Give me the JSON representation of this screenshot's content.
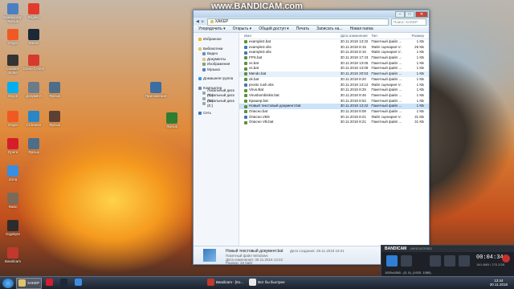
{
  "watermark": "www.BANDICAM.com",
  "desktop": {
    "icons": [
      {
        "label": "Компьютер Ярлык",
        "color": "#4a7fc1"
      },
      {
        "label": "Яндекс",
        "color": "#e23b2e"
      },
      {
        "label": "Origin",
        "color": "#f05a22"
      },
      {
        "label": "Steam",
        "color": "#1b2838"
      },
      {
        "label": "Counter-Strike",
        "color": "#333333"
      },
      {
        "label": "Game Center",
        "color": "#d63a2e"
      },
      {
        "label": "Skype",
        "color": "#00aff0"
      },
      {
        "label": "Документ",
        "color": "#6b7b8c"
      },
      {
        "label": "Ярлык",
        "color": "#4d6e8a"
      },
      {
        "label": "Origin",
        "color": "#f05a22"
      },
      {
        "label": "CCleaner",
        "color": "#2b86c5"
      },
      {
        "label": "Opera",
        "color": "#d51d2c"
      },
      {
        "label": "Ярлык",
        "color": "#4d6e8a"
      },
      {
        "label": "Zona",
        "color": "#3a8de0"
      },
      {
        "label": "Файл",
        "color": "#7a6a5a"
      },
      {
        "label": "Gigabyte",
        "color": "#2c2c2c"
      },
      {
        "label": "Bandicam",
        "color": "#c0392b"
      },
      {
        "label": "Приложение",
        "color": "#3a6ea5"
      },
      {
        "label": "Ярлык",
        "color": "#2e7d32"
      },
      {
        "label": "Ярлык",
        "color": "#5c4033"
      }
    ]
  },
  "explorer": {
    "address": "XAKEP",
    "search_placeholder": "Поиск: XAKEP",
    "toolbar": {
      "organize": "Упорядочить ▾",
      "open": "Открыть ▾",
      "share": "Общий доступ ▾",
      "print": "Печать",
      "burn": "Записать на...",
      "new_folder": "Новая папка"
    },
    "nav": {
      "favorites": "Избранное",
      "libraries": "Библиотеки",
      "video": "Видео",
      "documents": "Документы",
      "images": "Изображения",
      "music": "Музыка",
      "homegroup": "Домашняя группа",
      "computer": "Компьютер",
      "disk_c": "Локальный диск (C:)",
      "disk_d": "Локальный диск (D:)",
      "disk_e": "Локальный диск (E:)",
      "network": "Сеть"
    },
    "columns": {
      "name": "Имя",
      "date": "Дата изменения",
      "type": "Тип",
      "size": "Размер"
    },
    "files": [
      {
        "name": "example2.bat",
        "date": "30.11.2018 13:32",
        "type": "Пакетный файл ...",
        "size": "1 КБ"
      },
      {
        "name": "example3.vbs",
        "date": "30.11.2018 8:16",
        "type": "Файл сценария V...",
        "size": "26 КБ"
      },
      {
        "name": "example3.vbs",
        "date": "30.11.2018 8:16",
        "type": "Файл сценария V...",
        "size": "1 КБ"
      },
      {
        "name": "FPS.bat",
        "date": "30.11.2018 17:43",
        "type": "Пакетный файл ...",
        "size": "1 КБ"
      },
      {
        "name": "vs.bat",
        "date": "30.11.2018 13:06",
        "type": "Пакетный файл ...",
        "size": "1 КБ"
      },
      {
        "name": "vs.bat",
        "date": "30.11.2018 13:06",
        "type": "Пакетный файл ...",
        "size": "1 КБ"
      },
      {
        "name": "Mendo.bat",
        "date": "30.11.2018 20:53",
        "type": "Пакетный файл ...",
        "size": "1 КБ"
      },
      {
        "name": "ok.bat",
        "date": "30.11.2018 8:20",
        "type": "Пакетный файл ...",
        "size": "1 КБ"
      },
      {
        "name": "prosto rush.vbs",
        "date": "30.11.2018 13:12",
        "type": "Файл сценария V...",
        "size": "1 КБ"
      },
      {
        "name": "Virus.Bat",
        "date": "30.11.2018 8:25",
        "type": "Пакетный файл ...",
        "size": "1 КБ"
      },
      {
        "name": "Virusbombiskis.bat",
        "date": "30.11.2018 8:46",
        "type": "Пакетный файл ...",
        "size": "1 КБ"
      },
      {
        "name": "Крашер.bat",
        "date": "30.11.2018 8:52",
        "type": "Пакетный файл ...",
        "size": "1 КБ"
      },
      {
        "name": "Новый текстовый документ.bat",
        "date": "30.11.2018 13:22",
        "type": "Пакетный файл ...",
        "size": "1 КБ"
      },
      {
        "name": "Опасно.bat",
        "date": "30.11.2018 8:08",
        "type": "Пакетный файл ...",
        "size": "1 КБ"
      },
      {
        "name": "Опасно.VBS",
        "date": "30.11.2018 8:21",
        "type": "Файл сценария V...",
        "size": "31 КБ"
      },
      {
        "name": "Опасно VB.bat",
        "date": "30.11.2018 8:21",
        "type": "Пакетный файл ...",
        "size": "31 КБ"
      }
    ],
    "selected_index": 12,
    "hover_index": 6,
    "details": {
      "name": "Новый текстовый документ.bat",
      "type": "Пакетный файл Windows",
      "modified_label": "Дата изменения:",
      "modified": "30.11.2018 13:22",
      "size_label": "Размер:",
      "size": "28 байт",
      "created_label": "Дата создания:",
      "created": "28.11.2018 19:21"
    }
  },
  "bandicam": {
    "logo": "BANDICAM",
    "sub": "UNREGISTERED",
    "time": "00:04:34",
    "rate": "160.4MB / 270.2GB",
    "resolution": "1920x1080 - (0, 0), (1920, 1080)"
  },
  "taskbar": {
    "items": [
      {
        "label": "XAKEP",
        "color": "#e2c36b",
        "active": true
      },
      {
        "label": "",
        "color": "#d51d2c",
        "active": false
      },
      {
        "label": "",
        "color": "#1b2838",
        "active": false
      },
      {
        "label": "",
        "color": "#3a8de0",
        "active": false
      },
      {
        "label": "Bandicam - [Ко...",
        "color": "#c0392b",
        "active": false
      },
      {
        "label": "Вот бы быстрее",
        "color": "#e8e8e8",
        "active": false
      }
    ],
    "time": "13:44",
    "date": "30.11.2018"
  },
  "colors": {
    "accent": "#2f7fd4",
    "selection": "#cce3f8",
    "bat_icon": "#5e8f3a",
    "vbs_icon": "#3c7ab6"
  }
}
